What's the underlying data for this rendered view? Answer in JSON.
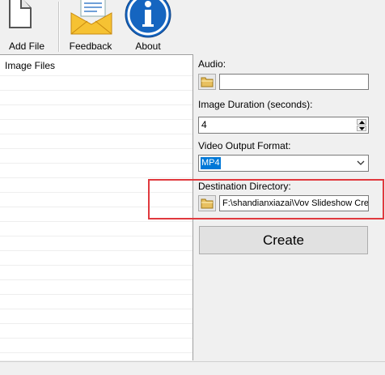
{
  "toolbar": {
    "add_file_label": "Add File",
    "feedback_label": "Feedback",
    "about_label": "About"
  },
  "file_list": {
    "header": "Image Files"
  },
  "audio": {
    "label": "Audio:",
    "value": ""
  },
  "image_duration": {
    "label": "Image Duration (seconds):",
    "value": "4"
  },
  "video_format": {
    "label": "Video Output Format:",
    "selected": "MP4"
  },
  "destination": {
    "label": "Destination Directory:",
    "value": "F:\\shandianxiazai\\Vov Slideshow Crea"
  },
  "create_button": {
    "label": "Create"
  },
  "colors": {
    "highlight_border": "#e0393e",
    "selection": "#0078d7",
    "about_icon": "#1565c0"
  }
}
